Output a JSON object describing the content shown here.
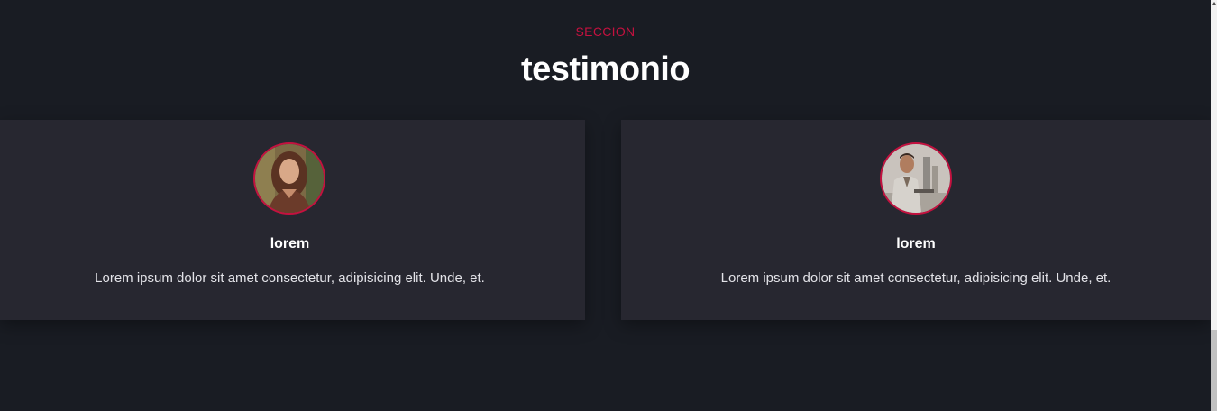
{
  "section": {
    "eyebrow": "SECCION",
    "title": "testimonio"
  },
  "testimonials": [
    {
      "name": "lorem",
      "text": "Lorem ipsum dolor sit amet consectetur, adipisicing elit. Unde, et.",
      "avatar_icon": "woman-portrait-avatar"
    },
    {
      "name": "lorem",
      "text": "Lorem ipsum dolor sit amet consectetur, adipisicing elit. Unde, et.",
      "avatar_icon": "man-portrait-avatar"
    }
  ],
  "colors": {
    "background": "#191c23",
    "card": "#272730",
    "accent": "#c4113f",
    "heading": "#ffffff",
    "text": "#e3e3e8"
  }
}
